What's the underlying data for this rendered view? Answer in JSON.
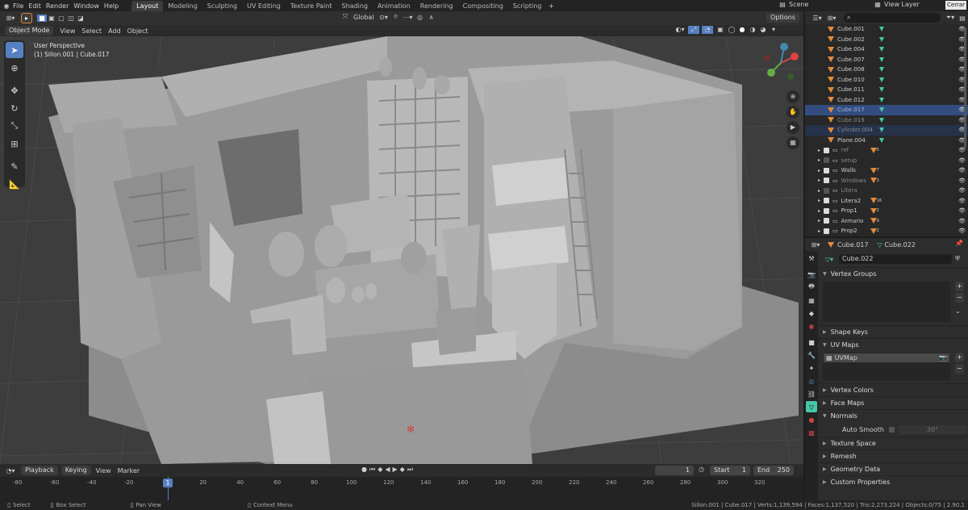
{
  "topbar": {
    "menus": [
      "File",
      "Edit",
      "Render",
      "Window",
      "Help"
    ],
    "workspaces": [
      "Layout",
      "Modeling",
      "Sculpting",
      "UV Editing",
      "Texture Paint",
      "Shading",
      "Animation",
      "Rendering",
      "Compositing",
      "Scripting"
    ],
    "active_workspace": "Layout",
    "scene_label": "Scene",
    "view_layer_label": "View Layer",
    "tooltip": "Cerrar"
  },
  "viewport_header": {
    "mode": "Object Mode",
    "menus": [
      "View",
      "Select",
      "Add",
      "Object"
    ],
    "transform_orientation": "Global",
    "options_label": "Options"
  },
  "viewport": {
    "perspective_label": "User Perspective",
    "object_info": "(1) Sillon.001 | Cube.017"
  },
  "outliner": {
    "search_placeholder": "",
    "rows": [
      {
        "name": "Cube.001",
        "type": "mesh",
        "selected": false
      },
      {
        "name": "Cube.002",
        "type": "mesh",
        "selected": false
      },
      {
        "name": "Cube.004",
        "type": "mesh",
        "selected": false
      },
      {
        "name": "Cube.007",
        "type": "mesh",
        "selected": false
      },
      {
        "name": "Cube.008",
        "type": "mesh",
        "selected": false
      },
      {
        "name": "Cube.010",
        "type": "mesh",
        "selected": false
      },
      {
        "name": "Cube.011",
        "type": "mesh",
        "selected": false
      },
      {
        "name": "Cube.012",
        "type": "mesh",
        "selected": false
      },
      {
        "name": "Cube.017",
        "type": "mesh",
        "selected": true
      },
      {
        "name": "Cube.019",
        "type": "mesh",
        "selected": false
      },
      {
        "name": "Cylinder.004",
        "type": "mesh",
        "selected": true
      },
      {
        "name": "Plane.004",
        "type": "mesh",
        "selected": false
      },
      {
        "name": "ref",
        "type": "collection",
        "selected": false,
        "badge": "5"
      },
      {
        "name": "setup",
        "type": "collection",
        "selected": false
      },
      {
        "name": "Walls",
        "type": "collection",
        "selected": false,
        "badge": "7"
      },
      {
        "name": "Windows",
        "type": "collection",
        "selected": false,
        "badge": "3"
      },
      {
        "name": "Litera",
        "type": "collection",
        "selected": false
      },
      {
        "name": "Litera2",
        "type": "collection",
        "selected": false,
        "badge": "16"
      },
      {
        "name": "Prop1",
        "type": "collection",
        "selected": false,
        "badge": "2"
      },
      {
        "name": "Armario",
        "type": "collection",
        "selected": false,
        "badge": "9"
      },
      {
        "name": "Prop2",
        "type": "collection",
        "selected": false,
        "badge": "2"
      }
    ]
  },
  "properties": {
    "object_name": "Cube.017",
    "mesh_name": "Cube.022",
    "data_name": "Cube.022",
    "panels": {
      "vertex_groups": "Vertex Groups",
      "shape_keys": "Shape Keys",
      "uv_maps": "UV Maps",
      "uv_map_item": "UVMap",
      "vertex_colors": "Vertex Colors",
      "face_maps": "Face Maps",
      "normals": "Normals",
      "auto_smooth": "Auto Smooth",
      "auto_smooth_angle": "30°",
      "texture_space": "Texture Space",
      "remesh": "Remesh",
      "geometry_data": "Geometry Data",
      "custom_properties": "Custom Properties"
    }
  },
  "timeline": {
    "menus": [
      "Playback",
      "Keying",
      "View",
      "Marker"
    ],
    "current_frame": "1",
    "start_label": "Start",
    "start_value": "1",
    "end_label": "End",
    "end_value": "250",
    "ruler": [
      "-80",
      "-60",
      "-40",
      "-20",
      "1",
      "20",
      "40",
      "60",
      "80",
      "100",
      "120",
      "140",
      "160",
      "180",
      "200",
      "220",
      "240",
      "260",
      "280",
      "300",
      "320"
    ]
  },
  "statusbar": {
    "select": "Select",
    "box_select": "Box Select",
    "pan_view": "Pan View",
    "context_menu": "Context Menu",
    "stats": "Sillon.001 | Cube.017 | Verts:1,139,594 | Faces:1,137,520 | Tris:2,273,224 | Objects:0/75 | 2.90.1"
  },
  "colors": {
    "accent": "#5680c2",
    "selected_row": "#334d80",
    "mesh_icon": "#e08c3c",
    "data_icon": "#48c7a8"
  }
}
